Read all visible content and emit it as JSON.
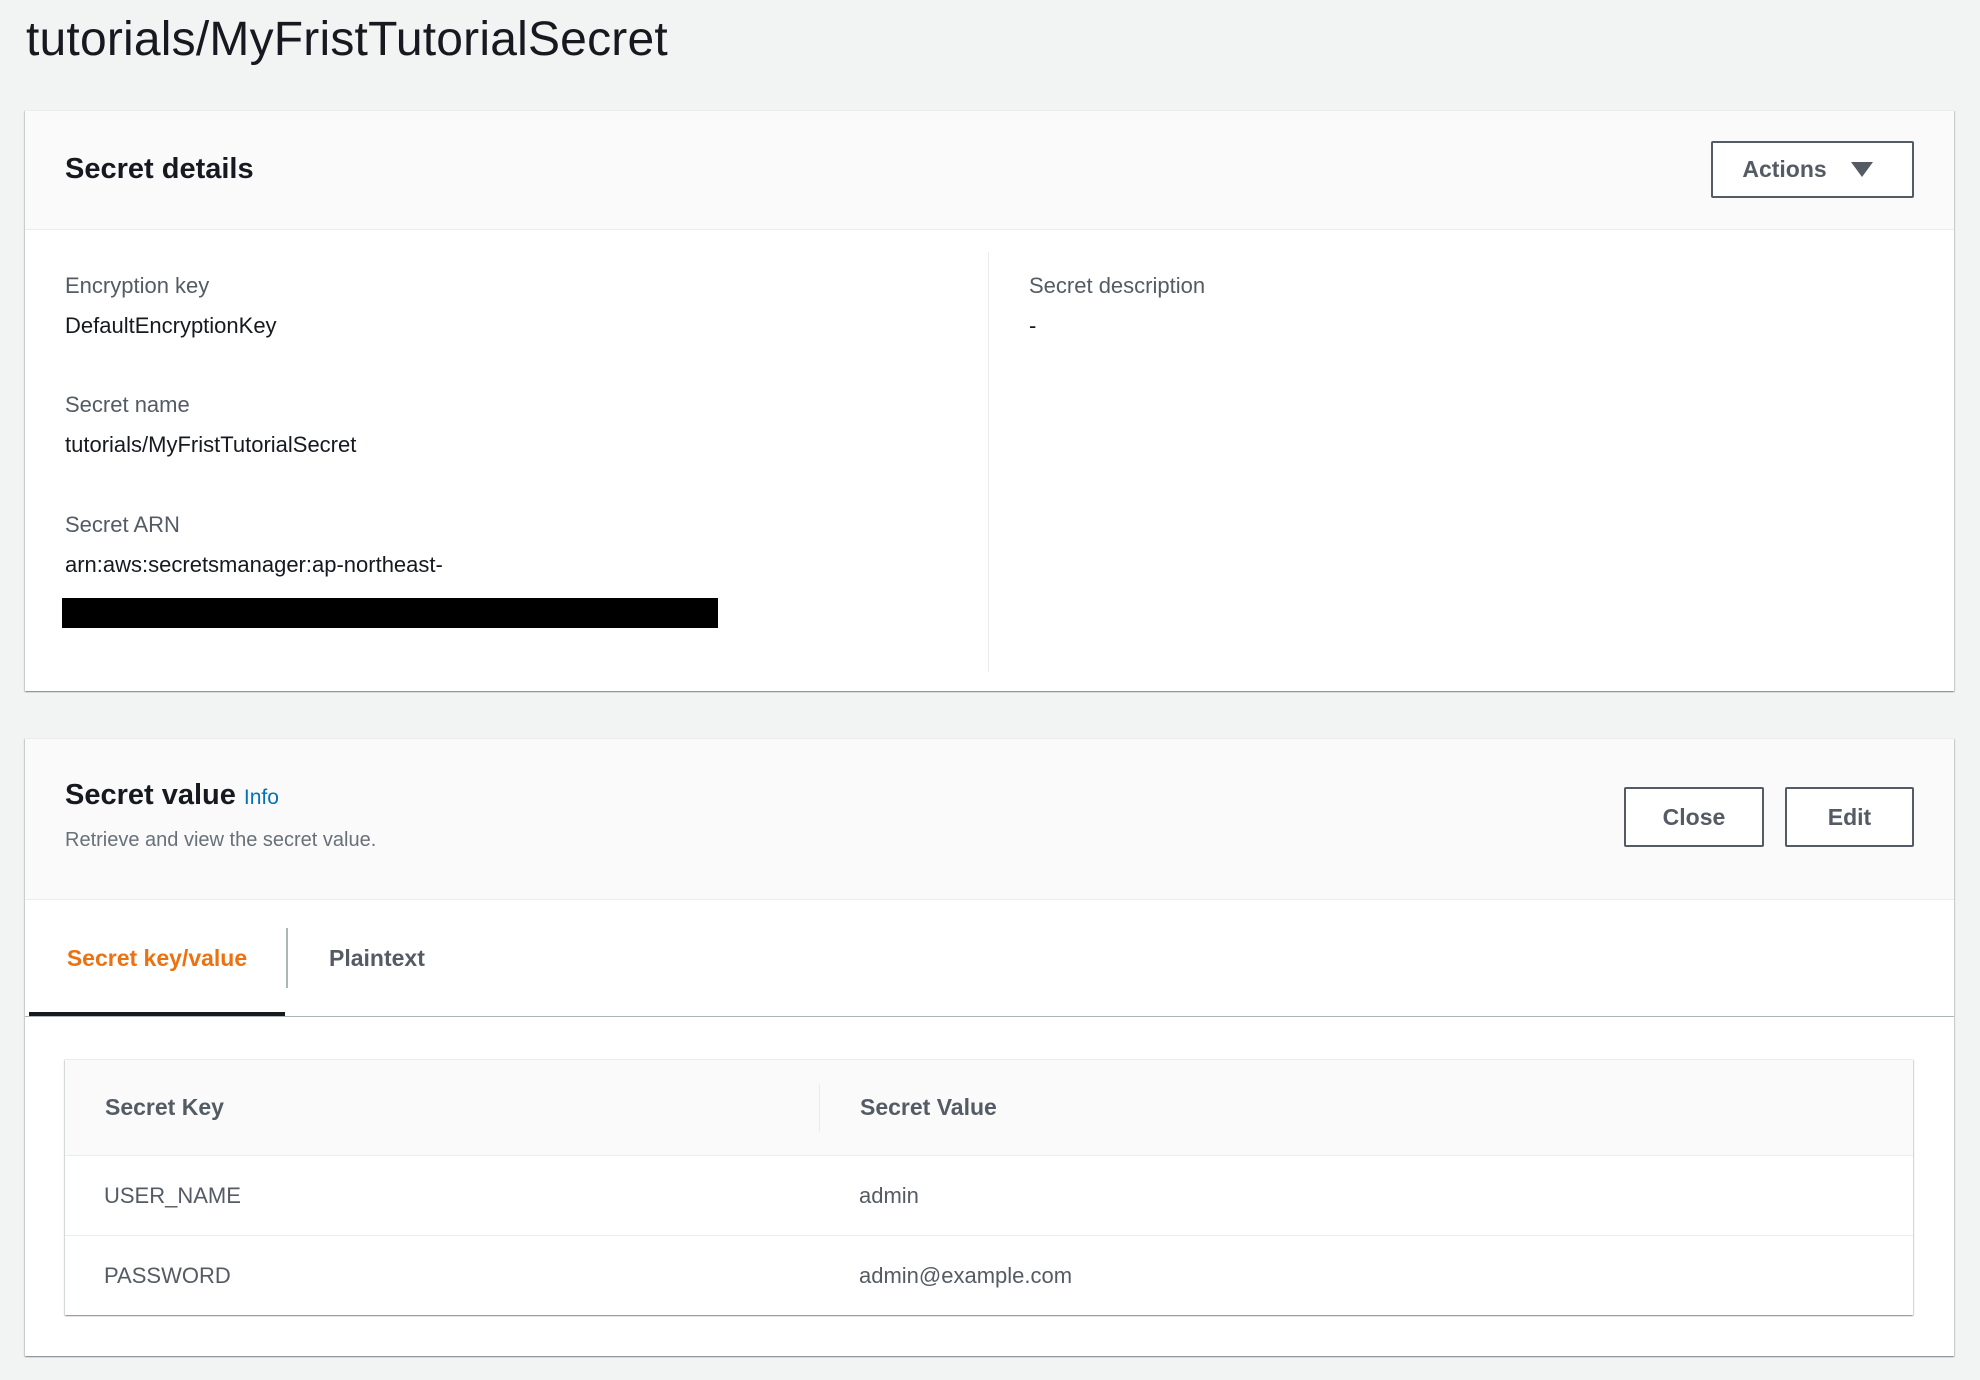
{
  "page": {
    "title": "tutorials/MyFristTutorialSecret"
  },
  "details": {
    "heading": "Secret details",
    "actions_label": "Actions",
    "encryption_key_label": "Encryption key",
    "encryption_key_value": "DefaultEncryptionKey",
    "secret_name_label": "Secret name",
    "secret_name_value": "tutorials/MyFristTutorialSecret",
    "secret_arn_label": "Secret ARN",
    "secret_arn_value": "arn:aws:secretsmanager:ap-northeast-",
    "description_label": "Secret description",
    "description_value": "-"
  },
  "secret_value": {
    "heading": "Secret value",
    "info_label": "Info",
    "subtitle": "Retrieve and view the secret value.",
    "close_label": "Close",
    "edit_label": "Edit",
    "tabs": [
      {
        "label": "Secret key/value",
        "active": true
      },
      {
        "label": "Plaintext",
        "active": false
      }
    ],
    "table": {
      "headers": [
        "Secret Key",
        "Secret Value"
      ],
      "rows": [
        {
          "key": "USER_NAME",
          "value": "admin"
        },
        {
          "key": "PASSWORD",
          "value": "admin@example.com"
        }
      ]
    }
  },
  "colors": {
    "page_bg": "#f2f3f3",
    "active_tab": "#ec7211",
    "link": "#0073bb",
    "text_primary": "#16191f",
    "text_secondary": "#545b64",
    "redaction": "#000000"
  },
  "icons": {
    "actions_caret": "caret-down-icon"
  }
}
